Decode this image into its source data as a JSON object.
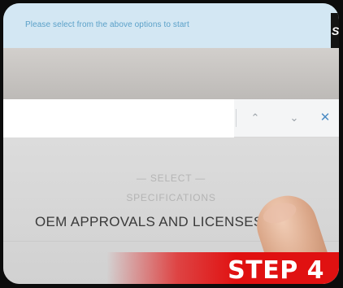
{
  "banner": {
    "text": "Please select from the above options to start"
  },
  "find_bar": {
    "up_icon": "chevron-up-icon",
    "down_icon": "chevron-down-icon",
    "close_icon": "close-icon"
  },
  "selector": {
    "select_label": "— SELECT —",
    "specifications_label": "SPECIFICATIONS",
    "option": "OEM APPROVALS AND LICENSES"
  },
  "step": {
    "label": "STEP 4"
  },
  "colors": {
    "banner_bg": "#d3e7f3",
    "banner_text": "#5aa0c8",
    "accent_red": "#e01111"
  }
}
